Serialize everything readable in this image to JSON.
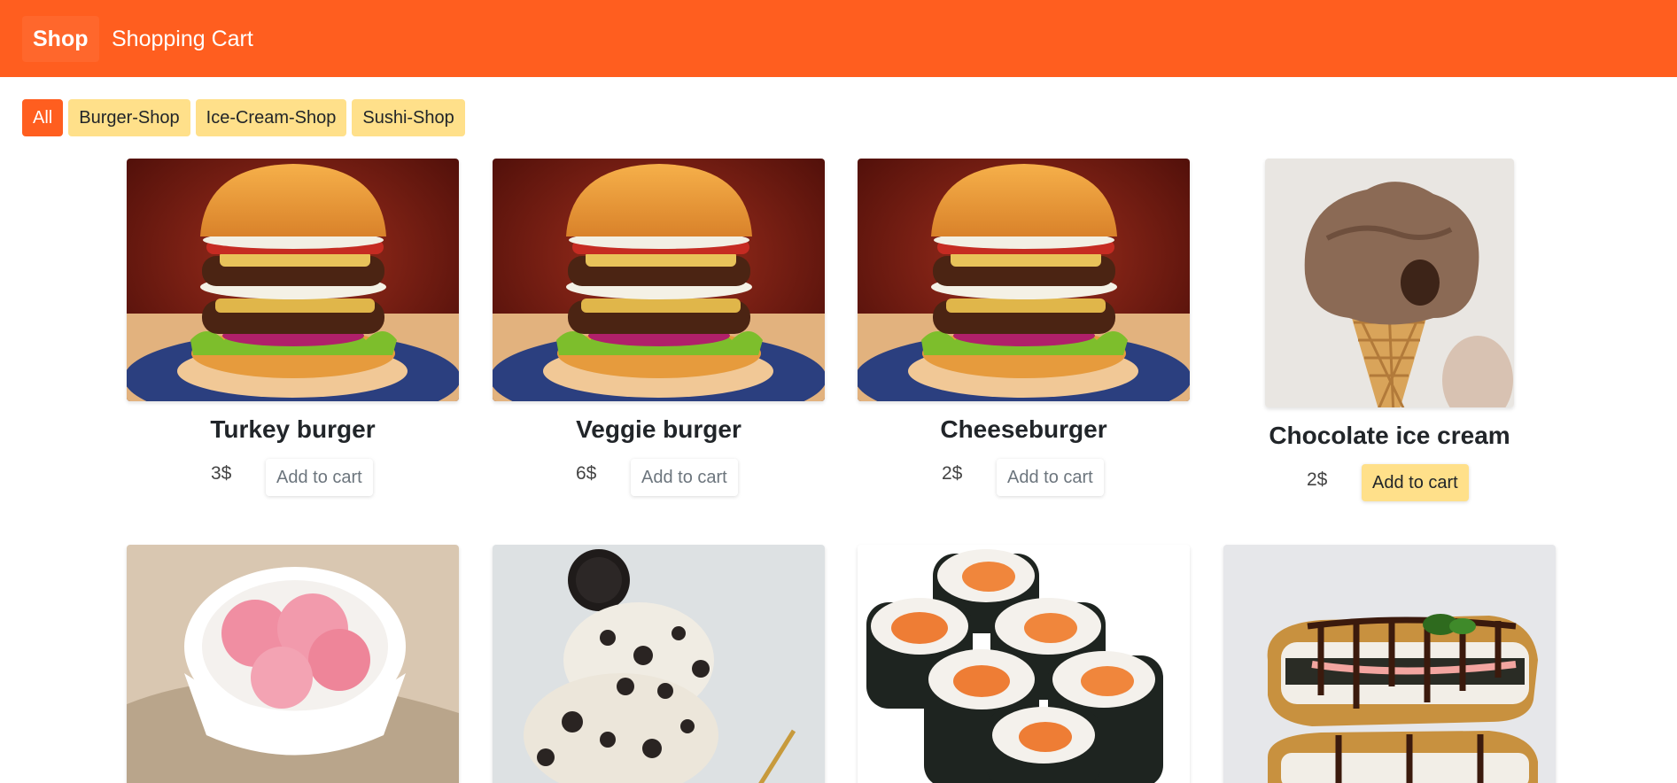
{
  "navbar": {
    "brand": "Shop",
    "link_cart": "Shopping Cart",
    "bg_color": "#ff5e1f"
  },
  "filters": [
    {
      "label": "All",
      "active": true
    },
    {
      "label": "Burger-Shop",
      "active": false
    },
    {
      "label": "Ice-Cream-Shop",
      "active": false
    },
    {
      "label": "Sushi-Shop",
      "active": false
    }
  ],
  "products": [
    {
      "name": "Turkey burger",
      "price": "3$",
      "button": "Add to cart",
      "image": "burger"
    },
    {
      "name": "Veggie burger",
      "price": "6$",
      "button": "Add to cart",
      "image": "burger"
    },
    {
      "name": "Cheeseburger",
      "price": "2$",
      "button": "Add to cart",
      "image": "burger"
    },
    {
      "name": "Chocolate ice cream",
      "price": "2$",
      "button": "Add to cart",
      "image": "chocolate-ice-cream-cone",
      "button_highlighted": true
    },
    {
      "image": "strawberry-ice-cream-bowl"
    },
    {
      "image": "cookies-and-cream-ice-cream"
    },
    {
      "image": "sushi-maki-rolls"
    },
    {
      "image": "sushi-sandwich"
    }
  ],
  "colors": {
    "accent": "#ff5e1f",
    "filter_bg": "#ffe08a"
  }
}
